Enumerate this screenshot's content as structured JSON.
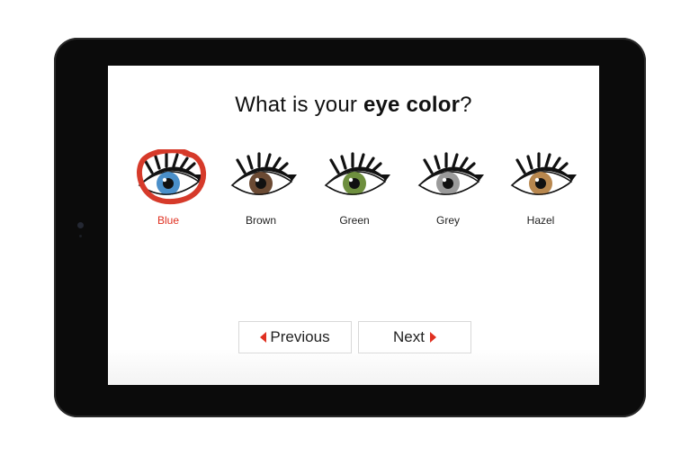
{
  "question": {
    "prefix": "What is your ",
    "emphasis": "eye color",
    "suffix": "?"
  },
  "options": [
    {
      "label": "Blue",
      "iris": "#4a8fc9",
      "selected": true
    },
    {
      "label": "Brown",
      "iris": "#6b4a33",
      "selected": false
    },
    {
      "label": "Green",
      "iris": "#6e8f3e",
      "selected": false
    },
    {
      "label": "Grey",
      "iris": "#9a9a9a",
      "selected": false
    },
    {
      "label": "Hazel",
      "iris": "#b8874e",
      "selected": false
    }
  ],
  "navigation": {
    "previous_label": "Previous",
    "next_label": "Next"
  },
  "colors": {
    "accent": "#e03020",
    "selection_ring": "#d63a2a"
  },
  "icons": {
    "previous": "caret-left-icon",
    "next": "caret-right-icon"
  }
}
